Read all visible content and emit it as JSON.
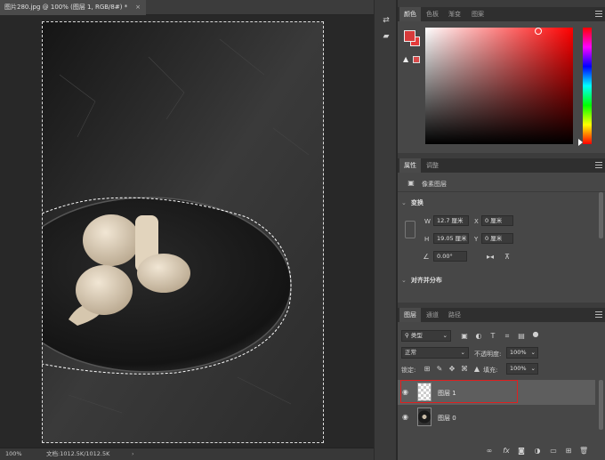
{
  "document": {
    "tab_title": "图片280.jpg @ 100% (图层 1, RGB/8#) *",
    "close_glyph": "×",
    "zoom": "100%",
    "status": "文档:1012.5K/1012.5K",
    "status_arrow": "›"
  },
  "color_panel": {
    "tabs": [
      "颜色",
      "色板",
      "渐变",
      "图案"
    ],
    "foreground_color": "#d73a3a",
    "background_color": "#e53b3b"
  },
  "properties_panel": {
    "tabs": [
      "属性",
      "调整"
    ],
    "subtitle": "像素图层",
    "transform_section": "变换",
    "w_label": "W",
    "w_value": "12.7 厘米",
    "x_label": "X",
    "x_value": "0 厘米",
    "h_label": "H",
    "h_value": "19.05 厘米",
    "y_label": "Y",
    "y_value": "0 厘米",
    "angle_value": "0.00°",
    "align_section": "对齐并分布"
  },
  "layers_panel": {
    "tabs": [
      "图层",
      "通道",
      "路径"
    ],
    "filter_kind": "类型",
    "blend_mode": "正常",
    "opacity_label": "不透明度:",
    "opacity_value": "100%",
    "lock_label": "锁定:",
    "fill_label": "填充:",
    "fill_value": "100%",
    "layers": [
      {
        "name": "图层 1",
        "selected": true,
        "thumb": "transparent"
      },
      {
        "name": "图层 0",
        "selected": false,
        "thumb": "photo"
      }
    ],
    "bottom_icons": [
      "link-icon",
      "fx-icon",
      "mask-icon",
      "adjustment-icon",
      "group-icon",
      "new-layer-icon",
      "trash-icon"
    ]
  },
  "accent_colors": {
    "highlight": "#e02020"
  }
}
